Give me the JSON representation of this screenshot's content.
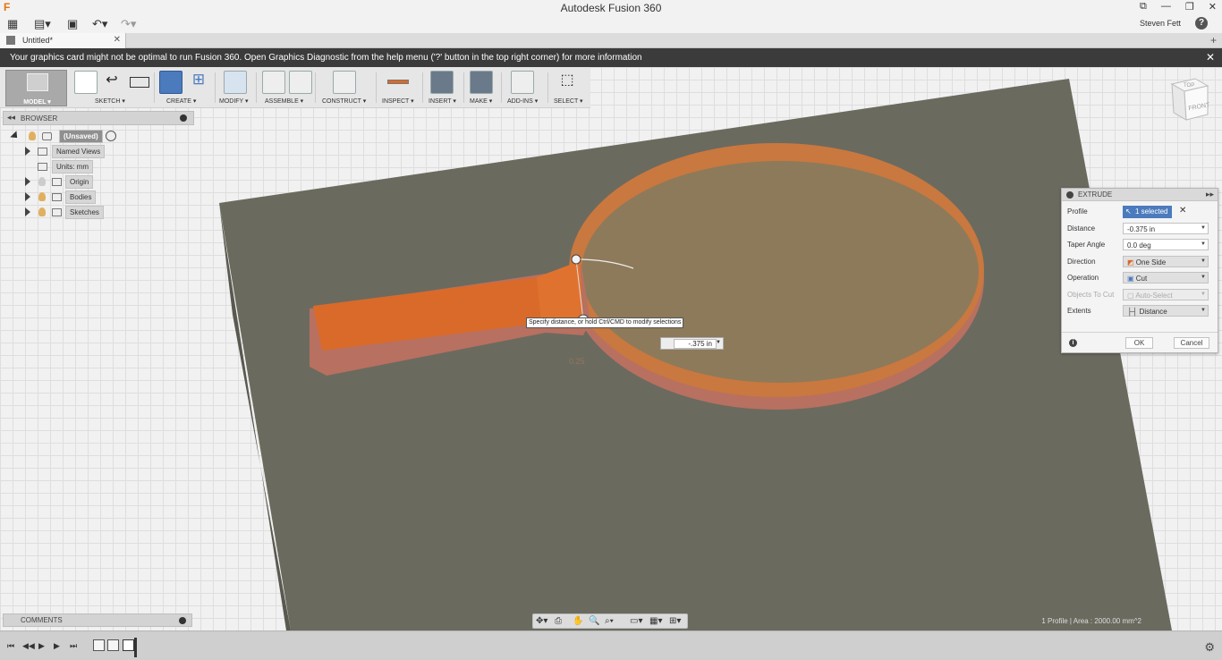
{
  "app": {
    "title": "Autodesk Fusion 360",
    "user": "Steven Fett",
    "help": "?",
    "window_buttons": [
      "⧉",
      "—",
      "❐",
      "✕"
    ]
  },
  "doc_tab": {
    "label": "Untitled*",
    "close": "✕",
    "new": "+"
  },
  "banner": {
    "message": "Your graphics card might not be optimal to run Fusion 360. Open Graphics Diagnostic from the help menu ('?' button in the top right corner) for more information",
    "close": "✕"
  },
  "toolbar": {
    "mode": "MODEL ▾",
    "groups": {
      "sketch": "SKETCH ▾",
      "create": "CREATE ▾",
      "modify": "MODIFY ▾",
      "assemble": "ASSEMBLE ▾",
      "construct": "CONSTRUCT ▾",
      "inspect": "INSPECT ▾",
      "insert": "INSERT ▾",
      "make": "MAKE ▾",
      "addins": "ADD-INS ▾",
      "select": "SELECT ▾"
    }
  },
  "browser": {
    "header": "BROWSER",
    "root": "(Unsaved)",
    "items": [
      "Named Views",
      "Units: mm",
      "Origin",
      "Bodies",
      "Sketches"
    ]
  },
  "comments": {
    "label": "COMMENTS"
  },
  "viewcube": {
    "top": "TOP",
    "front": "FRONT"
  },
  "viewport": {
    "tooltip": "Specify distance, or hold Ctrl/CMD to modify selections",
    "distance_input": "-.375 in",
    "ghost_value": "0.25"
  },
  "extrude": {
    "title": "EXTRUDE",
    "rows": {
      "profile": {
        "label": "Profile",
        "value": "1 selected"
      },
      "distance": {
        "label": "Distance",
        "value": "-0.375 in"
      },
      "taper": {
        "label": "Taper Angle",
        "value": "0.0 deg"
      },
      "direction": {
        "label": "Direction",
        "value": "One Side"
      },
      "operation": {
        "label": "Operation",
        "value": "Cut"
      },
      "objects": {
        "label": "Objects To Cut",
        "value": "Auto-Select"
      },
      "extents": {
        "label": "Extents",
        "value": "Distance"
      }
    },
    "ok": "OK",
    "cancel": "Cancel"
  },
  "status": {
    "profile_info": "1 Profile | Area : 2000.00 mm^2"
  },
  "colors": {
    "accent": "#4b7bbd",
    "banner": "#3b3b3b",
    "plate": "#6b6a5f",
    "cut_orange": "#d96a2a",
    "paddle_face": "#8d7a5a",
    "logo": "#e8720c"
  }
}
